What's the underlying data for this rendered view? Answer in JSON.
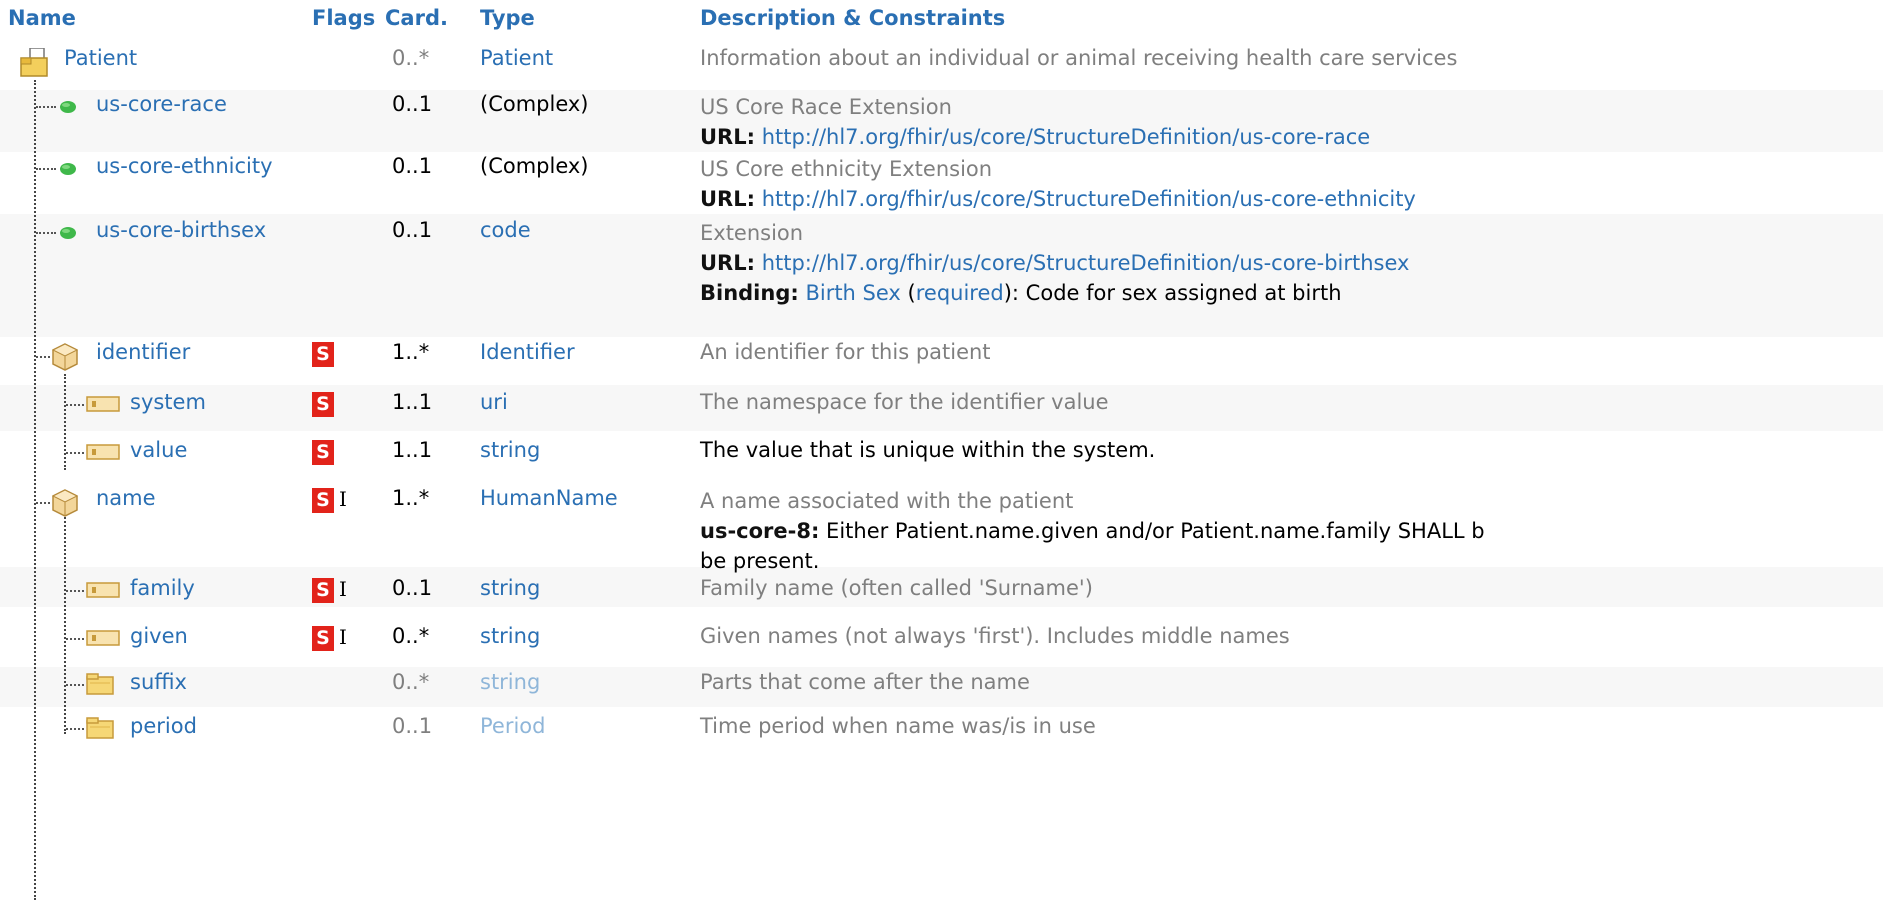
{
  "headers": {
    "name": "Name",
    "flags": "Flags",
    "card": "Card.",
    "type": "Type",
    "desc": "Description & Constraints"
  },
  "rows": [
    {
      "name": "Patient",
      "flag_s": "",
      "flag_i": "",
      "card": "0..*",
      "type": "Patient",
      "desc1": "Information about an individual or animal receiving health care services"
    },
    {
      "name": "us-core-race",
      "card": "0..1",
      "type": "(Complex)",
      "desc1": "US Core Race Extension",
      "url_label": "URL:",
      "url": "http://hl7.org/fhir/us/core/StructureDefinition/us-core-race"
    },
    {
      "name": "us-core-ethnicity",
      "card": "0..1",
      "type": "(Complex)",
      "desc1": "US Core ethnicity Extension",
      "url_label": "URL:",
      "url": "http://hl7.org/fhir/us/core/StructureDefinition/us-core-ethnicity"
    },
    {
      "name": "us-core-birthsex",
      "card": "0..1",
      "type": "code",
      "desc1": "Extension",
      "url_label": "URL:",
      "url": "http://hl7.org/fhir/us/core/StructureDefinition/us-core-birthsex",
      "binding_label": "Binding:",
      "binding_name": "Birth Sex",
      "binding_open": " (",
      "binding_strength": "required",
      "binding_rest": "): Code for sex assigned at birth"
    },
    {
      "name": "identifier",
      "flag_s": "S",
      "card": "1..*",
      "type": "Identifier",
      "desc1": "An identifier for this patient"
    },
    {
      "name": "system",
      "flag_s": "S",
      "card": "1..1",
      "type": "uri",
      "desc1": "The namespace for the identifier value"
    },
    {
      "name": "value",
      "flag_s": "S",
      "card": "1..1",
      "type": "string",
      "desc1": "The value that is unique within the system."
    },
    {
      "name": "name",
      "flag_s": "S",
      "flag_i": "I",
      "card": "1..*",
      "type": "HumanName",
      "desc1": "A name associated with the patient",
      "constraint_label": "us-core-8:",
      "constraint_text": " Either Patient.name.given and/or Patient.name.family SHALL b",
      "constraint_text2": "be present."
    },
    {
      "name": "family",
      "flag_s": "S",
      "flag_i": "I",
      "card": "0..1",
      "type": "string",
      "desc1": "Family name (often called 'Surname')"
    },
    {
      "name": "given",
      "flag_s": "S",
      "flag_i": "I",
      "card": "0..*",
      "type": "string",
      "desc1": "Given names (not always 'first'). Includes middle names"
    },
    {
      "name": "suffix",
      "card": "0..*",
      "type": "string",
      "desc1": "Parts that come after the name"
    },
    {
      "name": "period",
      "card": "0..1",
      "type": "Period",
      "desc1": "Time period when name was/is in use"
    }
  ],
  "colors": {
    "link": "#2a6fb3",
    "muted_link": "#8fb6d9",
    "flag_s_bg": "#e2231a",
    "row_shade": "#f7f7f7"
  }
}
